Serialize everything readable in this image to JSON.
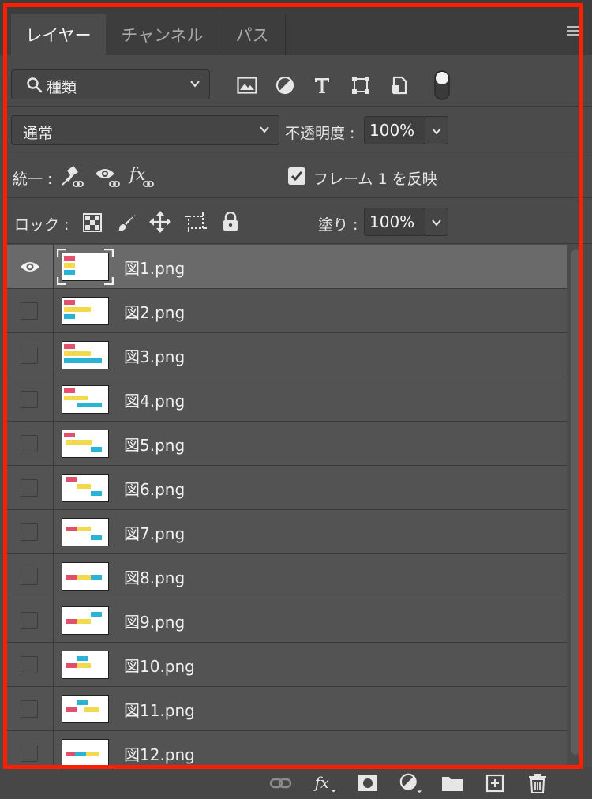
{
  "tabs": [
    {
      "label": "レイヤー",
      "active": true
    },
    {
      "label": "チャンネル",
      "active": false
    },
    {
      "label": "パス",
      "active": false
    }
  ],
  "filter": {
    "label": "種類",
    "icons": [
      "image-filter-icon",
      "adjustment-filter-icon",
      "type-filter-icon",
      "shape-filter-icon",
      "smart-object-filter-icon",
      "filter-toggle-icon"
    ]
  },
  "blend": {
    "mode": "通常",
    "opacity_label": "不透明度 :",
    "opacity_value": "100%"
  },
  "unify": {
    "label": "統一 :",
    "icons": [
      "unify-position-icon",
      "unify-visibility-icon",
      "unify-style-icon"
    ],
    "propagate_label": "フレーム 1 を反映",
    "propagate_checked": true
  },
  "lock": {
    "label": "ロック :",
    "icons": [
      "lock-transparent-icon",
      "lock-image-icon",
      "lock-position-icon",
      "lock-artboard-icon",
      "lock-all-icon"
    ],
    "fill_label": "塗り :",
    "fill_value": "100%"
  },
  "layers": [
    {
      "name": "図1.png",
      "visible": true,
      "selected": true
    },
    {
      "name": "図2.png",
      "visible": false,
      "selected": false
    },
    {
      "name": "図3.png",
      "visible": false,
      "selected": false
    },
    {
      "name": "図4.png",
      "visible": false,
      "selected": false
    },
    {
      "name": "図5.png",
      "visible": false,
      "selected": false
    },
    {
      "name": "図6.png",
      "visible": false,
      "selected": false
    },
    {
      "name": "図7.png",
      "visible": false,
      "selected": false
    },
    {
      "name": "図8.png",
      "visible": false,
      "selected": false
    },
    {
      "name": "図9.png",
      "visible": false,
      "selected": false
    },
    {
      "name": "図10.png",
      "visible": false,
      "selected": false
    },
    {
      "name": "図11.png",
      "visible": false,
      "selected": false
    },
    {
      "name": "図12.png",
      "visible": false,
      "selected": false
    }
  ],
  "footer_icons": [
    "link-layers-icon",
    "layer-style-icon",
    "add-mask-icon",
    "adjustment-layer-icon",
    "group-folder-icon",
    "new-layer-icon",
    "trash-icon"
  ],
  "colors": {
    "highlight": "#ff1e00",
    "red": "#e0506a",
    "yellow": "#f2d94e",
    "cyan": "#2bb3d6"
  }
}
